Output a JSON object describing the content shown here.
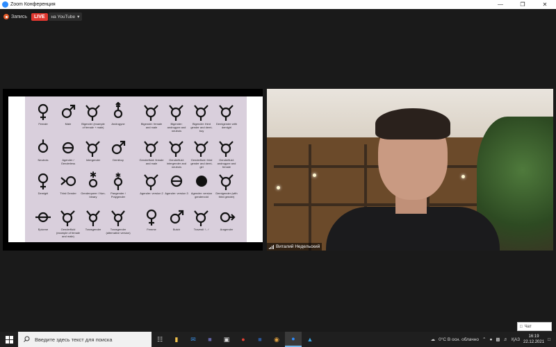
{
  "window": {
    "title": "Zoom Конференция"
  },
  "toolbar": {
    "record_label": "Запись",
    "live_badge": "LIVE",
    "stream_target": "на YouTube"
  },
  "slide": {
    "symbols": [
      {
        "label": "Female"
      },
      {
        "label": "Male"
      },
      {
        "label": "Bigender (example of female + male)"
      },
      {
        "label": "Androgyne"
      },
      {
        "label": "Bigender: female and male"
      },
      {
        "label": "Bigender: androgyne and neutrois"
      },
      {
        "label": "Bigender: third gender and demi-boy"
      },
      {
        "label": "Demigender with demigirl"
      },
      {
        "label": "Neutrois"
      },
      {
        "label": "Agender / Genderless"
      },
      {
        "label": "Intergender"
      },
      {
        "label": "Demiboy"
      },
      {
        "label": "Genderfluid: female and male"
      },
      {
        "label": "Genderfluid: intergender and neutrois"
      },
      {
        "label": "Genderfluid: third gender and demi-girl"
      },
      {
        "label": "Genderfluid: androgyne and female"
      },
      {
        "label": "Demigirl"
      },
      {
        "label": "Third Gender"
      },
      {
        "label": "Genderqueer / Non-binary"
      },
      {
        "label": "Pangender / Polygender"
      },
      {
        "label": "Agender: version 2"
      },
      {
        "label": "Agender: version 3"
      },
      {
        "label": "Agender: version gendervoid"
      },
      {
        "label": "Demigender (with third gender)"
      },
      {
        "label": "Epicene"
      },
      {
        "label": "Genderfluid (example of female and male)"
      },
      {
        "label": "Transgender"
      },
      {
        "label": "Transgender (alternative version)"
      },
      {
        "label": "Femme"
      },
      {
        "label": "Butch"
      },
      {
        "label": "Travesti ♀-♂"
      },
      {
        "label": "Aragender"
      }
    ]
  },
  "participant": {
    "name": "Виталий Недельский"
  },
  "chat": {
    "label": "Чат"
  },
  "taskbar": {
    "search_placeholder": "Введите здесь текст для поиска",
    "weather": "0°C  В осн. облачно",
    "lang": "ҚАЗ",
    "time": "16:19",
    "date": "22.12.2021"
  },
  "colors": {
    "live": "#e0372f",
    "zoom_blue": "#2d8cff",
    "slide_bg": "#d9cfdc"
  }
}
